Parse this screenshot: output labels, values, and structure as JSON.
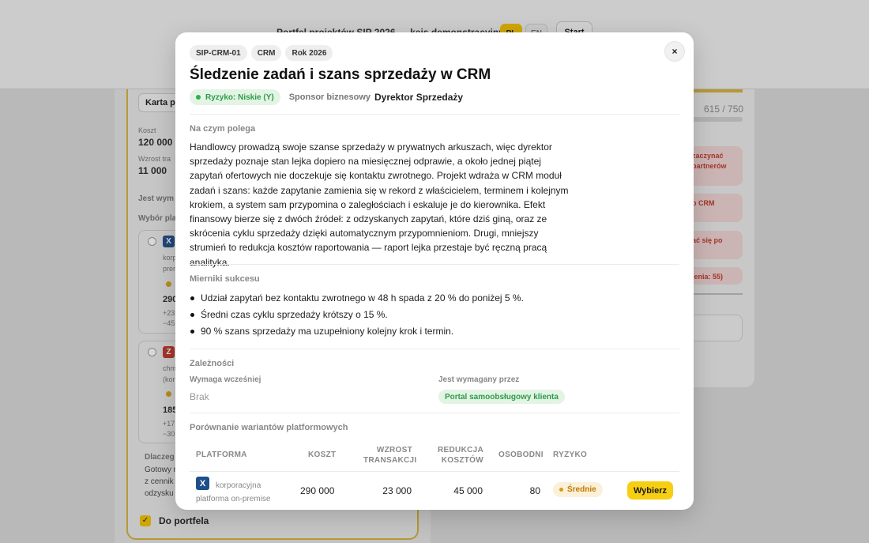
{
  "background": {
    "header_title": "Portfel projektów SIP 2026 — kejs demonstracyjny",
    "lang_pl": "PL",
    "lang_en": "EN",
    "start_label": "Start",
    "card_tab": "Karta p",
    "cost_label": "Koszt",
    "cost_value": "120 000",
    "growth_label": "Wzrost tra",
    "growth_value": "11 000",
    "required_label": "Jest wym",
    "choice_label": "Wybór plat",
    "option1": {
      "badge": "X",
      "text1": "korp",
      "text2": "prem",
      "value": "290",
      "delta1": "+23",
      "delta2": "−45"
    },
    "option2": {
      "badge": "Z",
      "text1": "chm",
      "text2": "(kor",
      "value": "185",
      "delta1": "+17",
      "delta2": "−30"
    },
    "why_label": "Dlaczeg",
    "why_text1": "Gotowy m",
    "why_text2": "z cennik",
    "why_text3": "odzysku",
    "portfolio_label": "Do portfela",
    "score": "615 / 750",
    "alerts": [
      "zaczynać partnerów",
      "o CRM",
      "ać się po",
      "ienia: 55)"
    ]
  },
  "modal": {
    "close_icon": "×",
    "tags": [
      "SIP-CRM-01",
      "CRM",
      "Rok 2026"
    ],
    "title": "Śledzenie zadań i szans sprzedaży w CRM",
    "risk_label": "Ryzyko: Niskie (Y)",
    "sponsor_label": "Sponsor biznesowy",
    "sponsor_value": "Dyrektor Sprzedaży",
    "what_heading": "Na czym polega",
    "description": "Handlowcy prowadzą swoje szanse sprzedaży w prywatnych arkuszach, więc dyrektor sprzedaży poznaje stan lejka dopiero na miesięcznej odprawie, a około jednej piątej zapytań ofertowych nie doczekuje się kontaktu zwrotnego. Projekt wdraża w CRM moduł zadań i szans: każde zapytanie zamienia się w rekord z właścicielem, terminem i kolejnym krokiem, a system sam przypomina o zaległościach i eskaluje je do kierownika. Efekt finansowy bierze się z dwóch źródeł: z odzyskanych zapytań, które dziś giną, oraz ze skrócenia cyklu sprzedaży dzięki automatycznym przypomnieniom. Drugi, mniejszy strumień to redukcja kosztów raportowania — raport lejka przestaje być ręczną pracą analityka.",
    "metrics_heading": "Mierniki sukcesu",
    "metrics": [
      "Udział zapytań bez kontaktu zwrotnego w 48 h spada z 20 % do poniżej 5 %.",
      "Średni czas cyklu sprzedaży krótszy o 15 %.",
      "90 % szans sprzedaży ma uzupełniony kolejny krok i termin."
    ],
    "deps_heading": "Zależności",
    "requires_label": "Wymaga wcześniej",
    "requires_value": "Brak",
    "required_by_label": "Jest wymagany przez",
    "required_by_value": "Portal samoobsługowy klienta",
    "compare_heading": "Porównanie wariantów platformowych",
    "table": {
      "headers": {
        "platform": "PLATFORMA",
        "cost": "KOSZT",
        "growth_1": "WZROST",
        "growth_2": "TRANSAKCJI",
        "reduction_1": "REDUKCJA",
        "reduction_2": "KOSZTÓW",
        "mandays": "OSOBODNI",
        "risk": "RYZYKO"
      },
      "rows": [
        {
          "badge": "X",
          "platform": "korporacyjna platforma on-premise",
          "cost": "290 000",
          "growth": "23 000",
          "reduction": "45 000",
          "mandays": "80",
          "risk": "Średnie",
          "action": "Wybierz"
        }
      ]
    }
  },
  "colors": {
    "accent": "#f6cf12",
    "risk_low": "#2e9b47",
    "risk_mid": "#c27a00",
    "platform_blue": "#1f4e8c",
    "platform_red": "#c0392b"
  }
}
